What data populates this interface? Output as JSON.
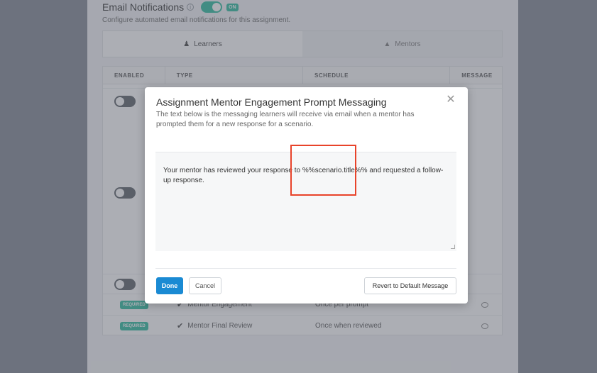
{
  "background": {
    "section": {
      "title": "Email Notifications",
      "toggle_badge": "ON",
      "description": "Configure automated email notifications for this assignment."
    },
    "tabs": [
      {
        "label": "Learners",
        "icon": "user-icon"
      },
      {
        "label": "Mentors",
        "icon": "graduation-cap-icon"
      }
    ],
    "table": {
      "headers": [
        "ENABLED",
        "TYPE",
        "SCHEDULE",
        "MESSAGE"
      ],
      "rows": [
        {
          "enabled": "REQUIRED",
          "type": "Mentor Engagement",
          "schedule": "Once per prompt"
        },
        {
          "enabled": "REQUIRED",
          "type": "Mentor Final Review",
          "schedule": "Once when reviewed"
        }
      ]
    }
  },
  "modal": {
    "title": "Assignment Mentor Engagement Prompt Messaging",
    "description": "The text below is the messaging learners will receive via email when a mentor has prompted them for a new response for a scenario.",
    "message": "Your mentor has reviewed your response to %%scenario.title%% and requested a follow-up response.",
    "buttons": {
      "done": "Done",
      "cancel": "Cancel",
      "revert": "Revert to Default Message"
    }
  },
  "colors": {
    "accent": "#1a8ad3",
    "toggle_on": "#3ec1a7",
    "highlight": "#e8432a"
  }
}
